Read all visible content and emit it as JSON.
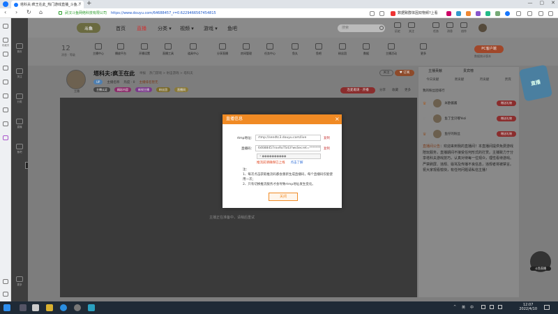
{
  "browser": {
    "tab_title": "塔科夫:疯王在此_热门游戏直播_斗鱼...",
    "tab_close": "×",
    "new_tab": "+",
    "nav_back": "‹",
    "nav_forward": "›",
    "nav_refresh": "↻",
    "nav_home": "⌂",
    "url_org": "武汉斗鱼网络科技有限公司",
    "url": "https://www.douyu.com/64688457_r=0.6229466567454815",
    "news_ticker": "数据致群体因双物频?上看",
    "window_controls": [
      "—",
      "▢",
      "✕"
    ]
  },
  "side_panel": {
    "items": [
      {
        "label": ""
      },
      {
        "label": "收藏夹"
      },
      {
        "label": "历史记录"
      },
      {
        "label": "下载"
      },
      {
        "label": "小程序"
      },
      {
        "label": "工具箱"
      }
    ],
    "bottom": "设置"
  },
  "douyu_left": {
    "items": [
      "首页",
      "关注",
      "分类",
      "直播",
      "鱼吧",
      "游戏",
      "更多"
    ],
    "volume_label": "-43.7 dB"
  },
  "site_nav": {
    "logo": "斗鱼",
    "links": [
      "首页",
      "直播",
      "分类 ▾",
      "视频 ▾",
      "游戏 ▾",
      "鱼吧"
    ],
    "search_placeholder": "搜索",
    "header_icons": [
      "历史",
      "关注",
      "任务",
      "消息",
      "创作"
    ]
  },
  "toolbar": {
    "level_num": "12",
    "level_sub": "消息 · 等级",
    "items": [
      "主播中心",
      "播放平台",
      "开播设置",
      "直播工具",
      "道具中心",
      "分享直播",
      "房间管理",
      "任务中心",
      "鱼丸",
      "鱼吧",
      "粉丝团",
      "数据",
      "主播活动",
      "更多"
    ],
    "pc_button": "PC客户端",
    "pc_sub": "数据统计版本"
  },
  "streamer": {
    "room_title": "塔科夫:疯王在此",
    "report": "举报",
    "breadcrumb": "热门游戏 > 射击游戏 > 塔科夫",
    "uid_tag": "UP",
    "name": "主播名称",
    "hot": "热度 · 0",
    "rank_hint": "主播排名暂无",
    "tags": [
      "主播认证",
      "精彩内容",
      "新锐主播",
      "粉丝团",
      "直播间"
    ],
    "follow": "关注",
    "subscribe": "♥ 订阅",
    "rec_live": "连麦邀请 · 开播",
    "mini_actions": [
      "分享",
      "收藏",
      "更多"
    ],
    "avatar_sub": "主播"
  },
  "player": {
    "status": "主播正在准备中，请稍后重试"
  },
  "right_panel": {
    "head": [
      "主播贡献",
      "贵宾榜"
    ],
    "tabs": [
      "今日贡献",
      "周贡献",
      "月贡献",
      "贵宾"
    ],
    "rank_title": "我的粉丝团排行",
    "rank_rows": [
      {
        "name": "米欧酱酱",
        "badge": "赠送礼物"
      },
      {
        "name": "鱼丁宝贝嘟Yezi",
        "badge": "赠送礼物"
      },
      {
        "name": "鱼仔的粉丝",
        "badge": "赠送礼物"
      }
    ],
    "notice_tag": "直播间公告",
    "notice_body": "：欢迎来到我的直播间！本直播间提供免费游戏陪玩服务，直播期间不接受任何形式的打赏。主播致力于分享塔科夫游戏技巧，认真对待每一位观众，理性看待游戏。严禁刷屏、违规、辱骂及传播不良信息，违规者将被禁言。祝大家观看愉快，有任何问题请私信主播！",
    "side_art": "直播",
    "mascot_label": "斗鱼直播"
  },
  "modal": {
    "title": "直播信息",
    "close": "×",
    "rtmp_label": "rtmp地址：",
    "rtmp_value": "rtmp://sendtc3.douyu.com/live",
    "key_label": "直播码：",
    "key_value": "64688457rovRoTS43?wsSecret=**********",
    "copy": "复制",
    "select_placeholder": "• ●●●●●●●●●●",
    "warning": "推流前请确保已上线",
    "learn_more": "点击了解",
    "notes_title": "注：",
    "note1": "1、每次点击获取推流码都会重新生成直播码，每个直播码仅能使用一次；",
    "note2": "2、只有切换推流服务才会导致rtmp地址发生变化。",
    "ok": "关闭"
  },
  "taskbar": {
    "time": "12:07",
    "date": "2022/4/10",
    "tray": [
      "^",
      "英",
      "中"
    ]
  }
}
